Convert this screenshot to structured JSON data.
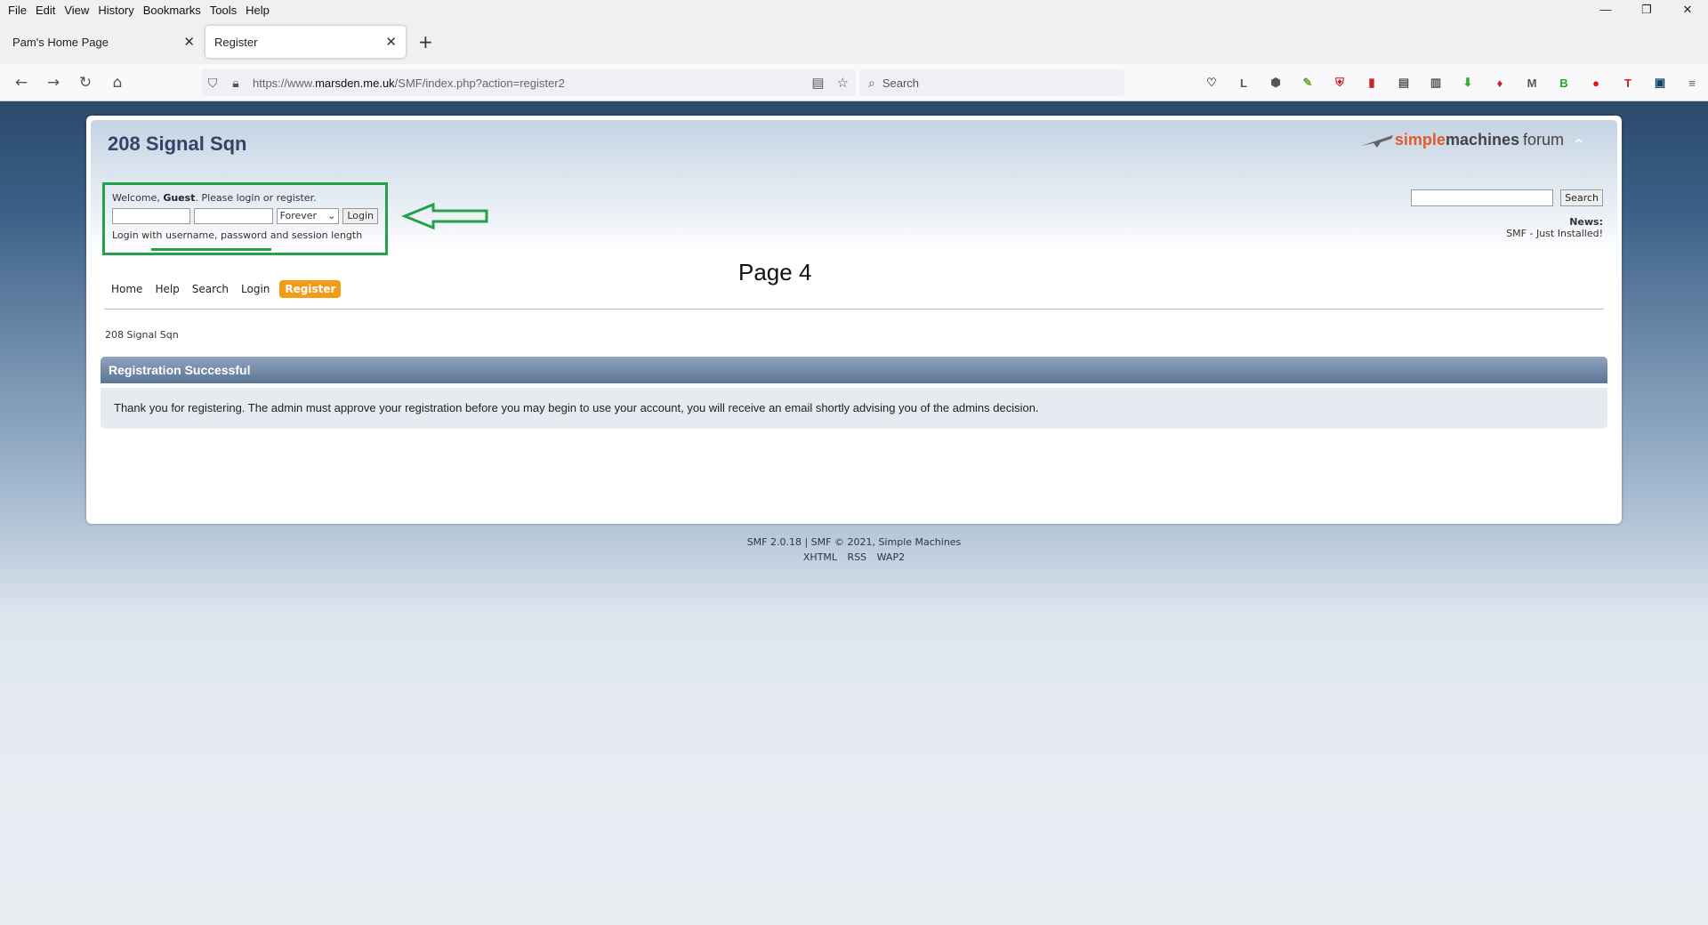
{
  "menubar": {
    "items": [
      "File",
      "Edit",
      "View",
      "History",
      "Bookmarks",
      "Tools",
      "Help"
    ]
  },
  "window_controls": {
    "minimize": "—",
    "restore": "❐",
    "close": "✕"
  },
  "tabs": [
    {
      "title": "Pam's Home Page",
      "close": "✕"
    },
    {
      "title": "Register",
      "close": "✕"
    }
  ],
  "new_tab": "+",
  "nav": {
    "back": "←",
    "forward": "→",
    "reload": "↻",
    "home": "⌂",
    "url_prefix": "https://www.",
    "url_domain": "marsden.me.uk",
    "url_path": "/SMF/index.php?action=register2",
    "search_placeholder": "Search"
  },
  "extensions": [
    "♡",
    "L",
    "⬢",
    "✎",
    "⛨",
    "▮",
    "▤",
    "▥",
    "⬇",
    "♦",
    "M",
    "B",
    "●",
    "T",
    "▣",
    "≡"
  ],
  "forum": {
    "title": "208 Signal Sqn",
    "logo": {
      "part1": "simple",
      "part2": "machines",
      "part3": "forum"
    },
    "collapse": "⌃"
  },
  "userbox": {
    "welcome_prefix": "Welcome, ",
    "guest": "Guest",
    "welcome_suffix": ". Please login or register.",
    "session_option": "Forever",
    "login_button": "Login",
    "hint": "Login with username, password and session length"
  },
  "search": {
    "button": "Search"
  },
  "news": {
    "label": "News:",
    "text": "SMF - Just Installed!"
  },
  "annotation": {
    "page_label": "Page 4"
  },
  "main_menu": [
    "Home",
    "Help",
    "Search",
    "Login",
    "Register"
  ],
  "linktree": "208 Signal Sqn",
  "content": {
    "header": "Registration Successful",
    "message": "Thank you for registering. The admin must approve your registration before you may begin to use your account, you will receive an email shortly advising you of the admins decision."
  },
  "footer": {
    "line1": "SMF 2.0.18 | SMF © 2021, Simple Machines",
    "links": [
      "XHTML",
      "RSS",
      "WAP2"
    ]
  },
  "colors": {
    "annotation_green": "#22a34a",
    "register_orange": "#f39a16",
    "header_blue": "#5b7596"
  }
}
